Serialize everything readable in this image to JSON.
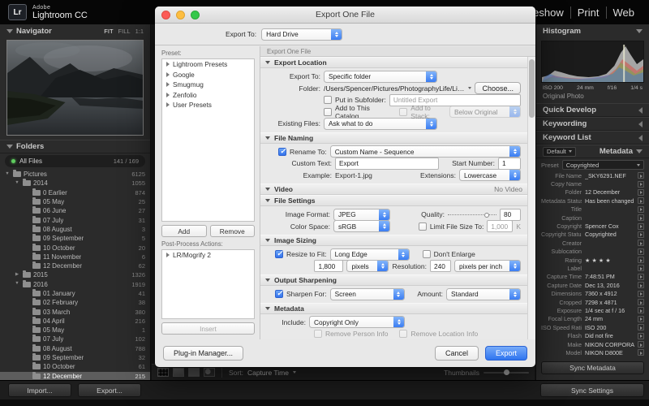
{
  "app": {
    "logo": "Lr",
    "brand_top": "Adobe",
    "brand_bottom": "Lightroom CC",
    "modules": [
      "lideshow",
      "Print",
      "Web"
    ]
  },
  "left_panel": {
    "navigator": {
      "title": "Navigator",
      "zoom_options": [
        {
          "label": "FIT",
          "active": true
        },
        {
          "label": "FILL",
          "active": false
        },
        {
          "label": "1:1",
          "active": false
        }
      ]
    },
    "folders": {
      "title": "Folders",
      "all_files_label": "All Files",
      "all_files_count": "141 / 169",
      "tree": [
        {
          "twisty": "▼",
          "label": "Pictures",
          "count": "6125",
          "level": 0
        },
        {
          "twisty": "▼",
          "label": "2014",
          "count": "1055",
          "level": 1
        },
        {
          "twisty": "",
          "label": "0 Earlier",
          "count": "874",
          "level": 2
        },
        {
          "twisty": "",
          "label": "05 May",
          "count": "25",
          "level": 2
        },
        {
          "twisty": "",
          "label": "06 June",
          "count": "27",
          "level": 2
        },
        {
          "twisty": "",
          "label": "07 July",
          "count": "31",
          "level": 2
        },
        {
          "twisty": "",
          "label": "08 August",
          "count": "3",
          "level": 2
        },
        {
          "twisty": "",
          "label": "09 September",
          "count": "5",
          "level": 2
        },
        {
          "twisty": "",
          "label": "10 October",
          "count": "20",
          "level": 2
        },
        {
          "twisty": "",
          "label": "11 November",
          "count": "6",
          "level": 2
        },
        {
          "twisty": "",
          "label": "12 December",
          "count": "62",
          "level": 2
        },
        {
          "twisty": "▶",
          "label": "2015",
          "count": "1326",
          "level": 1
        },
        {
          "twisty": "▼",
          "label": "2016",
          "count": "1919",
          "level": 1
        },
        {
          "twisty": "",
          "label": "01 January",
          "count": "41",
          "level": 2
        },
        {
          "twisty": "",
          "label": "02 February",
          "count": "38",
          "level": 2
        },
        {
          "twisty": "",
          "label": "03 March",
          "count": "380",
          "level": 2
        },
        {
          "twisty": "",
          "label": "04 April",
          "count": "216",
          "level": 2
        },
        {
          "twisty": "",
          "label": "05 May",
          "count": "1",
          "level": 2
        },
        {
          "twisty": "",
          "label": "07 July",
          "count": "102",
          "level": 2
        },
        {
          "twisty": "",
          "label": "08 August",
          "count": "788",
          "level": 2
        },
        {
          "twisty": "",
          "label": "09 September",
          "count": "32",
          "level": 2
        },
        {
          "twisty": "",
          "label": "10 October",
          "count": "61",
          "level": 2
        },
        {
          "twisty": "",
          "label": "12 December",
          "count": "215",
          "level": 2,
          "selected": true
        }
      ]
    }
  },
  "right_panel": {
    "histogram": {
      "title": "Histogram",
      "exif": [
        "ISO 200",
        "24 mm",
        "f/16",
        "1/4 s"
      ],
      "photo_label": "Original Photo"
    },
    "collapsed_sections": [
      "Quick Develop",
      "Keywording",
      "Keyword List"
    ],
    "metadata": {
      "view": "Default",
      "title": "Metadata",
      "preset_label": "Preset",
      "preset_value": "Copyrighted",
      "fields": [
        {
          "label": "File Name",
          "value": "_SKY6291.NEF"
        },
        {
          "label": "Copy Name",
          "value": ""
        },
        {
          "label": "Folder",
          "value": "12 December"
        },
        {
          "label": "Metadata Status",
          "value": "Has been changed"
        },
        {
          "label": "Title",
          "value": ""
        },
        {
          "label": "Caption",
          "value": ""
        },
        {
          "label": "Copyright",
          "value": "Spencer Cox"
        },
        {
          "label": "Copyright Status",
          "value": "Copyrighted"
        },
        {
          "label": "Creator",
          "value": ""
        },
        {
          "label": "Sublocation",
          "value": ""
        },
        {
          "label": "Rating",
          "value": "★ ★ ★ ★"
        },
        {
          "label": "Label",
          "value": ""
        },
        {
          "label": "Capture Time",
          "value": "7:48:51 PM"
        },
        {
          "label": "Capture Date",
          "value": "Dec 13, 2016"
        },
        {
          "label": "Dimensions",
          "value": "7360 x 4912"
        },
        {
          "label": "Cropped",
          "value": "7298 x 4871"
        },
        {
          "label": "Exposure",
          "value": "1/4 sec at f / 16"
        },
        {
          "label": "Focal Length",
          "value": "24 mm"
        },
        {
          "label": "ISO Speed Rating",
          "value": "ISO 200"
        },
        {
          "label": "Flash",
          "value": "Did not fire"
        },
        {
          "label": "Make",
          "value": "NIKON CORPORATION"
        },
        {
          "label": "Model",
          "value": "NIKON D800E"
        }
      ]
    },
    "sync_metadata_button": "Sync Metadata"
  },
  "toolbar": {
    "sort_label": "Sort:",
    "sort_value": "Capture Time",
    "thumbnails_label": "Thumbnails"
  },
  "bottom": {
    "import_button": "Import...",
    "export_button": "Export...",
    "sync_settings_button": "Sync Settings"
  },
  "dialog": {
    "title": "Export One File",
    "export_to_label": "Export To:",
    "export_to_value": "Hard Drive",
    "preset_label": "Preset:",
    "presets": [
      "Lightroom Presets",
      "Google",
      "Smugmug",
      "Zenfolio",
      "User Presets"
    ],
    "add_button": "Add",
    "remove_button": "Remove",
    "post_process_label": "Post-Process Actions:",
    "post_process_items": [
      "LR/Mogrify 2"
    ],
    "insert_button": "Insert",
    "plugin_manager_button": "Plug-in Manager...",
    "panel_header": "Export One File",
    "cancel_button": "Cancel",
    "export_button": "Export",
    "sections": {
      "export_location": {
        "title": "Export Location",
        "export_to_label": "Export To:",
        "export_to_value": "Specific folder",
        "folder_label": "Folder:",
        "folder_value": "/Users/Spencer/Pictures/PhotographyLife/Lightroom",
        "choose_button": "Choose...",
        "put_in_subfolder_label": "Put in Subfolder:",
        "subfolder_value": "Untitled Export",
        "add_to_catalog_label": "Add to This Catalog",
        "add_to_stack_label": "Add to Stack:",
        "stack_value": "Below Original",
        "existing_files_label": "Existing Files:",
        "existing_files_value": "Ask what to do"
      },
      "file_naming": {
        "title": "File Naming",
        "rename_label": "Rename To:",
        "rename_value": "Custom Name - Sequence",
        "custom_text_label": "Custom Text:",
        "custom_text_value": "Export",
        "start_number_label": "Start Number:",
        "start_number_value": "1",
        "example_label": "Example:",
        "example_value": "Export-1.jpg",
        "extensions_label": "Extensions:",
        "extensions_value": "Lowercase"
      },
      "video": {
        "title": "Video",
        "status": "No Video"
      },
      "file_settings": {
        "title": "File Settings",
        "image_format_label": "Image Format:",
        "image_format_value": "JPEG",
        "quality_label": "Quality:",
        "quality_value": "80",
        "color_space_label": "Color Space:",
        "color_space_value": "sRGB",
        "limit_label": "Limit File Size To:",
        "limit_value": "1,000",
        "limit_unit": "K"
      },
      "image_sizing": {
        "title": "Image Sizing",
        "resize_label": "Resize to Fit:",
        "resize_value": "Long Edge",
        "dont_enlarge_label": "Don't Enlarge",
        "size_value": "1,800",
        "size_unit": "pixels",
        "resolution_label": "Resolution:",
        "resolution_value": "240",
        "resolution_unit": "pixels per inch"
      },
      "output_sharpening": {
        "title": "Output Sharpening",
        "sharpen_label": "Sharpen For:",
        "sharpen_value": "Screen",
        "amount_label": "Amount:",
        "amount_value": "Standard"
      },
      "metadata": {
        "title": "Metadata",
        "include_label": "Include:",
        "include_value": "Copyright Only",
        "remove_person_label": "Remove Person Info",
        "remove_location_label": "Remove Location Info"
      }
    }
  },
  "colors": {
    "accent_blue": "#3b7df2",
    "panel_dark": "#2b2b2b",
    "dialog_bg": "#e8e8e8"
  }
}
